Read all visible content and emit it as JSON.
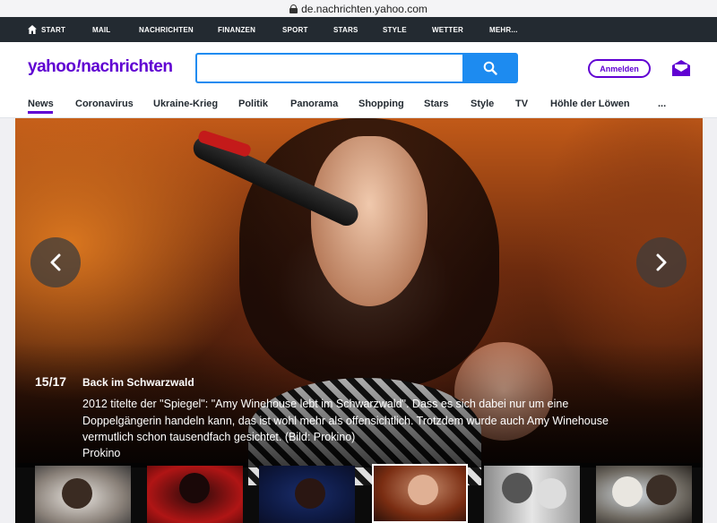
{
  "browser": {
    "url": "de.nachrichten.yahoo.com"
  },
  "topnav": {
    "items": [
      {
        "label": "START"
      },
      {
        "label": "MAIL"
      },
      {
        "label": "NACHRICHTEN"
      },
      {
        "label": "FINANZEN"
      },
      {
        "label": "SPORT"
      },
      {
        "label": "STARS"
      },
      {
        "label": "STYLE"
      },
      {
        "label": "WETTER"
      },
      {
        "label": "MEHR..."
      }
    ]
  },
  "header": {
    "logo_yahoo": "yahoo",
    "logo_bang": "!",
    "logo_section": "nachrichten",
    "search_placeholder": "",
    "signin_label": "Anmelden",
    "brand_color": "#6001d2",
    "accent_color": "#1d8bf0"
  },
  "subnav": {
    "active": "News",
    "tabs": [
      {
        "label": "News"
      },
      {
        "label": "Coronavirus"
      },
      {
        "label": "Ukraine-Krieg"
      },
      {
        "label": "Politik"
      },
      {
        "label": "Panorama"
      },
      {
        "label": "Shopping"
      },
      {
        "label": "Stars"
      },
      {
        "label": "Style"
      },
      {
        "label": "TV"
      },
      {
        "label": "Höhle der Löwen"
      },
      {
        "label": "..."
      }
    ]
  },
  "slideshow": {
    "counter": "15/17",
    "title": "Back im Schwarzwald",
    "caption": "2012 titelte der \"Spiegel\": \"Amy Winehouse lebt im Schwarzwald\". Dass es sich dabei nur um eine Doppelgängerin handeln kann, das ist wohl mehr als offensichtlich. Trotzdem wurde auch Amy Winehouse vermutlich schon tausendfach gesichtet. (Bild: Prokino)",
    "credit": "Prokino",
    "prev_icon": "chevron-left-icon",
    "next_icon": "chevron-right-icon",
    "thumbnails_count_visible": 6,
    "active_thumbnail": 4
  }
}
